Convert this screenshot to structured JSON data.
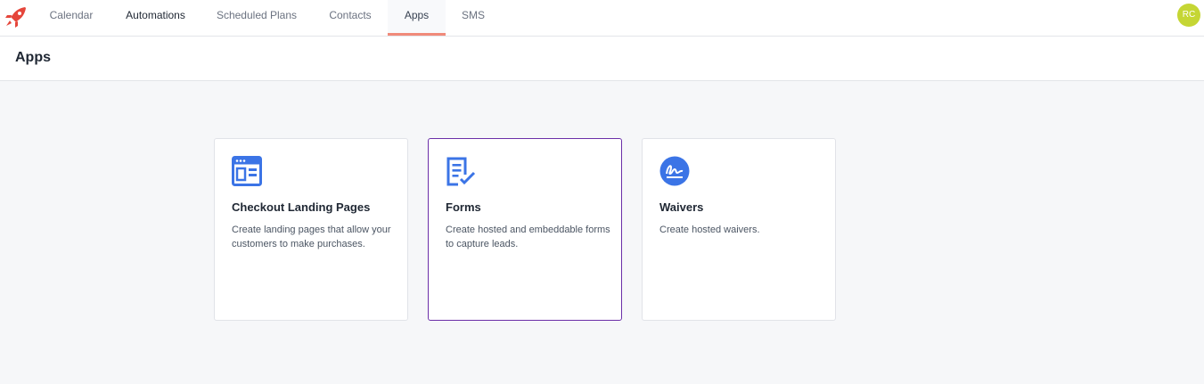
{
  "nav": {
    "items": [
      {
        "label": "Calendar"
      },
      {
        "label": "Automations"
      },
      {
        "label": "Scheduled Plans"
      },
      {
        "label": "Contacts"
      },
      {
        "label": "Apps"
      },
      {
        "label": "SMS"
      }
    ],
    "active_index": 4,
    "avatar_initials": "RC"
  },
  "header": {
    "title": "Apps"
  },
  "apps": [
    {
      "title": "Checkout Landing Pages",
      "description": "Create landing pages that allow your customers to make purchases.",
      "icon": "landing-page-icon"
    },
    {
      "title": "Forms",
      "description": "Create hosted and embeddable forms to capture leads.",
      "icon": "form-check-icon"
    },
    {
      "title": "Waivers",
      "description": "Create hosted waivers.",
      "icon": "signature-icon"
    }
  ],
  "colors": {
    "accent": "#f08a7a",
    "icon_blue": "#3b74e6",
    "selected_border": "#6b2fa8",
    "avatar": "#c5d634",
    "logo": "#e5463b"
  }
}
